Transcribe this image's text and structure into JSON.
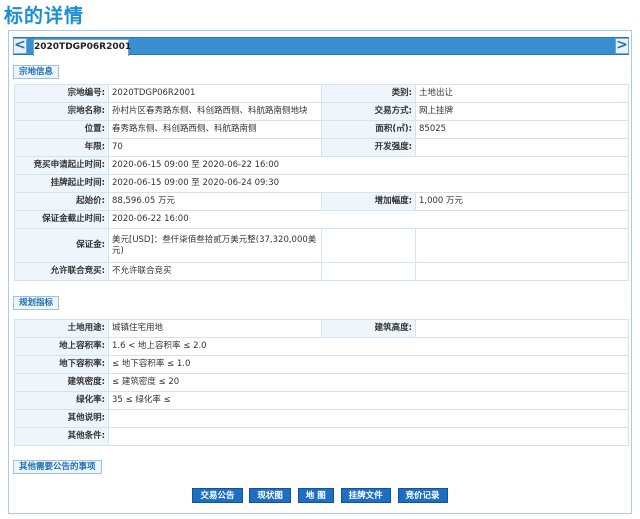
{
  "page_title": "标的详情",
  "tab": {
    "label": "2020TDGP06R2001"
  },
  "nav": {
    "prev": "<",
    "next": ">"
  },
  "sections": {
    "parcel_info": "宗地信息",
    "planning": "规划指标",
    "other": "其他需要公告的事项"
  },
  "parcel": {
    "code_label": "宗地编号:",
    "code": "2020TDGP06R2001",
    "category_label": "类别:",
    "category": "土地出让",
    "name_label": "宗地名称:",
    "name": "孙村片区春秀路东侧、科创路西侧、科航路南侧地块",
    "trade_label": "交易方式:",
    "trade": "网上挂牌",
    "location_label": "位置:",
    "location": "春秀路东侧、科创路西侧、科航路南侧",
    "area_label": "面积(㎡):",
    "area": "85025",
    "years_label": "年限:",
    "years": "70",
    "dev_label": "开发强度:",
    "dev": "",
    "apply_label": "竞买申请起止时间:",
    "apply": "2020-06-15 09:00 至 2020-06-22 16:00",
    "listing_label": "挂牌起止时间:",
    "listing": "2020-06-15 09:00 至 2020-06-24 09:30",
    "start_price_label": "起始价:",
    "start_price": "88,596.05 万元",
    "increment_label": "增加幅度:",
    "increment": "1,000 万元",
    "deposit_deadline_label": "保证金截止时间:",
    "deposit_deadline": "2020-06-22 16:00",
    "deposit_label": "保证金:",
    "deposit_line1": "美元[USD]：叁仟柒佰叁拾贰万美元整(37,320,000美",
    "deposit_line2": "元)",
    "joint_label": "允许联合竞买:",
    "joint": "不允许联合竞买"
  },
  "plan": {
    "use_label": "土地用途:",
    "use": "城镇住宅用地",
    "height_label": "建筑高度:",
    "height": "",
    "far_above_label": "地上容积率:",
    "far_above": "1.6 < 地上容积率 ≤ 2.0",
    "far_below_label": "地下容积率:",
    "far_below": "≤ 地下容积率 ≤ 1.0",
    "density_label": "建筑密度:",
    "density": "≤ 建筑密度 ≤ 20",
    "green_label": "绿化率:",
    "green": "35 ≤ 绿化率 ≤",
    "notes_label": "其他说明:",
    "notes": "",
    "conditions_label": "其他条件:",
    "conditions": ""
  },
  "buttons": {
    "announcement": "交易公告",
    "status_map": "现状图",
    "map": "地 图",
    "listing_docs": "挂牌文件",
    "bid_records": "竞价记录"
  }
}
